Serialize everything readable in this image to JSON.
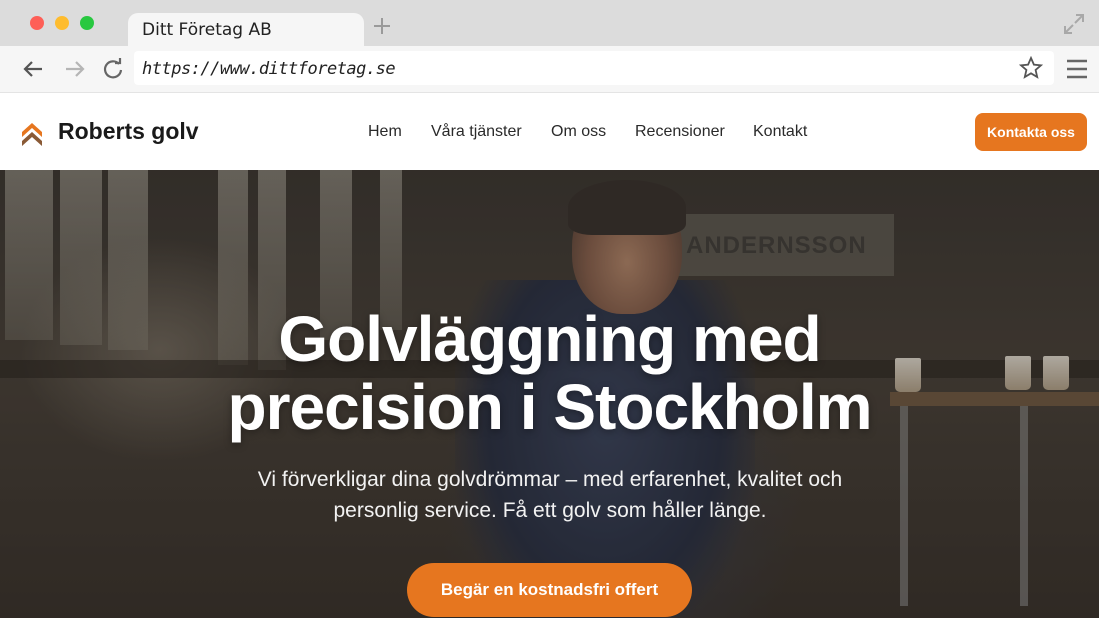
{
  "browser": {
    "tab_title": "Ditt Företag AB",
    "url": "https://www.dittforetag.se"
  },
  "site": {
    "brand": "Roberts golv",
    "nav": [
      "Hem",
      "Våra tjänster",
      "Om oss",
      "Recensioner",
      "Kontakt"
    ],
    "cta_top": "Kontakta oss",
    "accent_color": "#e6761f"
  },
  "hero": {
    "title_line1": "Golvläggning med",
    "title_line2": "precision i Stockholm",
    "subtitle_line1": "Vi förverkligar dina golvdrömmar – med erfarenhet, kvalitet och",
    "subtitle_line2": "personlig service. Få ett golv som håller länge.",
    "cta": "Begär en kostnadsfri offert",
    "background_sign": "ANDERNSSON"
  }
}
